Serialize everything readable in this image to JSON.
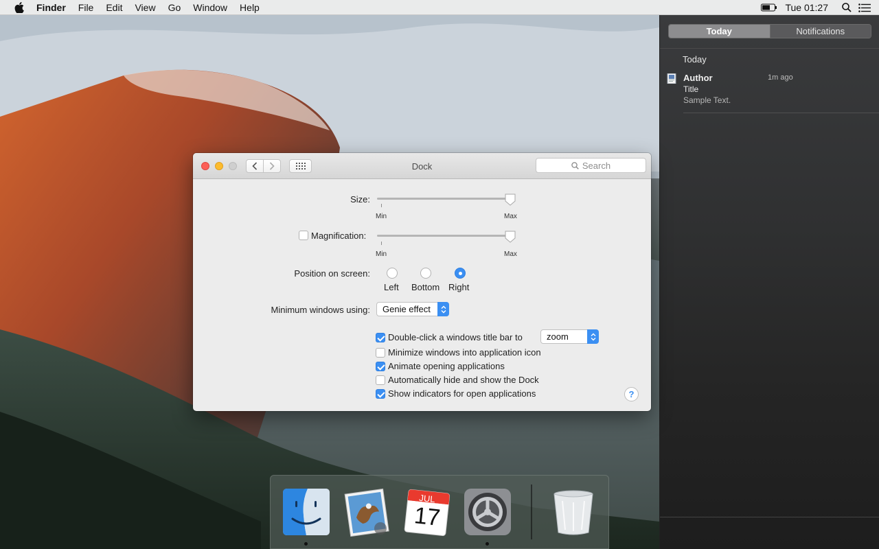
{
  "menubar": {
    "app_name": "Finder",
    "items": [
      "File",
      "Edit",
      "View",
      "Go",
      "Window",
      "Help"
    ],
    "clock": "Tue 01:27",
    "icons": [
      "apple-icon",
      "battery-icon",
      "spotlight-icon",
      "notification-center-icon"
    ]
  },
  "notification_center": {
    "tabs": [
      {
        "label": "Today",
        "active": true
      },
      {
        "label": "Notifications",
        "active": false
      }
    ],
    "heading": "Today",
    "item": {
      "author": "Author",
      "time": "1m ago",
      "title": "Title",
      "text": "Sample Text."
    }
  },
  "window": {
    "title": "Dock",
    "search_placeholder": "Search",
    "size": {
      "label": "Size:",
      "min_label": "Min",
      "max_label": "Max",
      "value": 1.0
    },
    "magnification": {
      "label": "Magnification:",
      "checked": false,
      "min_label": "Min",
      "max_label": "Max",
      "value": 1.0
    },
    "position": {
      "label": "Position on screen:",
      "options": [
        "Left",
        "Bottom",
        "Right"
      ],
      "selected": "Right"
    },
    "minimize": {
      "label": "Minimum windows using:",
      "value": "Genie effect"
    },
    "options": [
      {
        "label": "Double-click a windows title bar to",
        "checked": true
      },
      {
        "label": "Minimize windows into application icon",
        "checked": false
      },
      {
        "label": "Animate opening applications",
        "checked": true
      },
      {
        "label": "Automatically hide and show the Dock",
        "checked": false
      },
      {
        "label": "Show indicators for open applications",
        "checked": true
      }
    ],
    "double_click_action": "zoom",
    "help": "?"
  },
  "dock": {
    "apps": [
      {
        "name": "Finder",
        "running": true
      },
      {
        "name": "Mail",
        "running": false
      },
      {
        "name": "Calendar",
        "running": false,
        "month": "JUL",
        "day": "17"
      },
      {
        "name": "System Preferences",
        "running": true
      },
      {
        "name": "Trash",
        "running": false
      }
    ]
  },
  "colors": {
    "accent": "#3b8ff2",
    "close": "#fc5f57",
    "minimize": "#fdbc2e"
  }
}
